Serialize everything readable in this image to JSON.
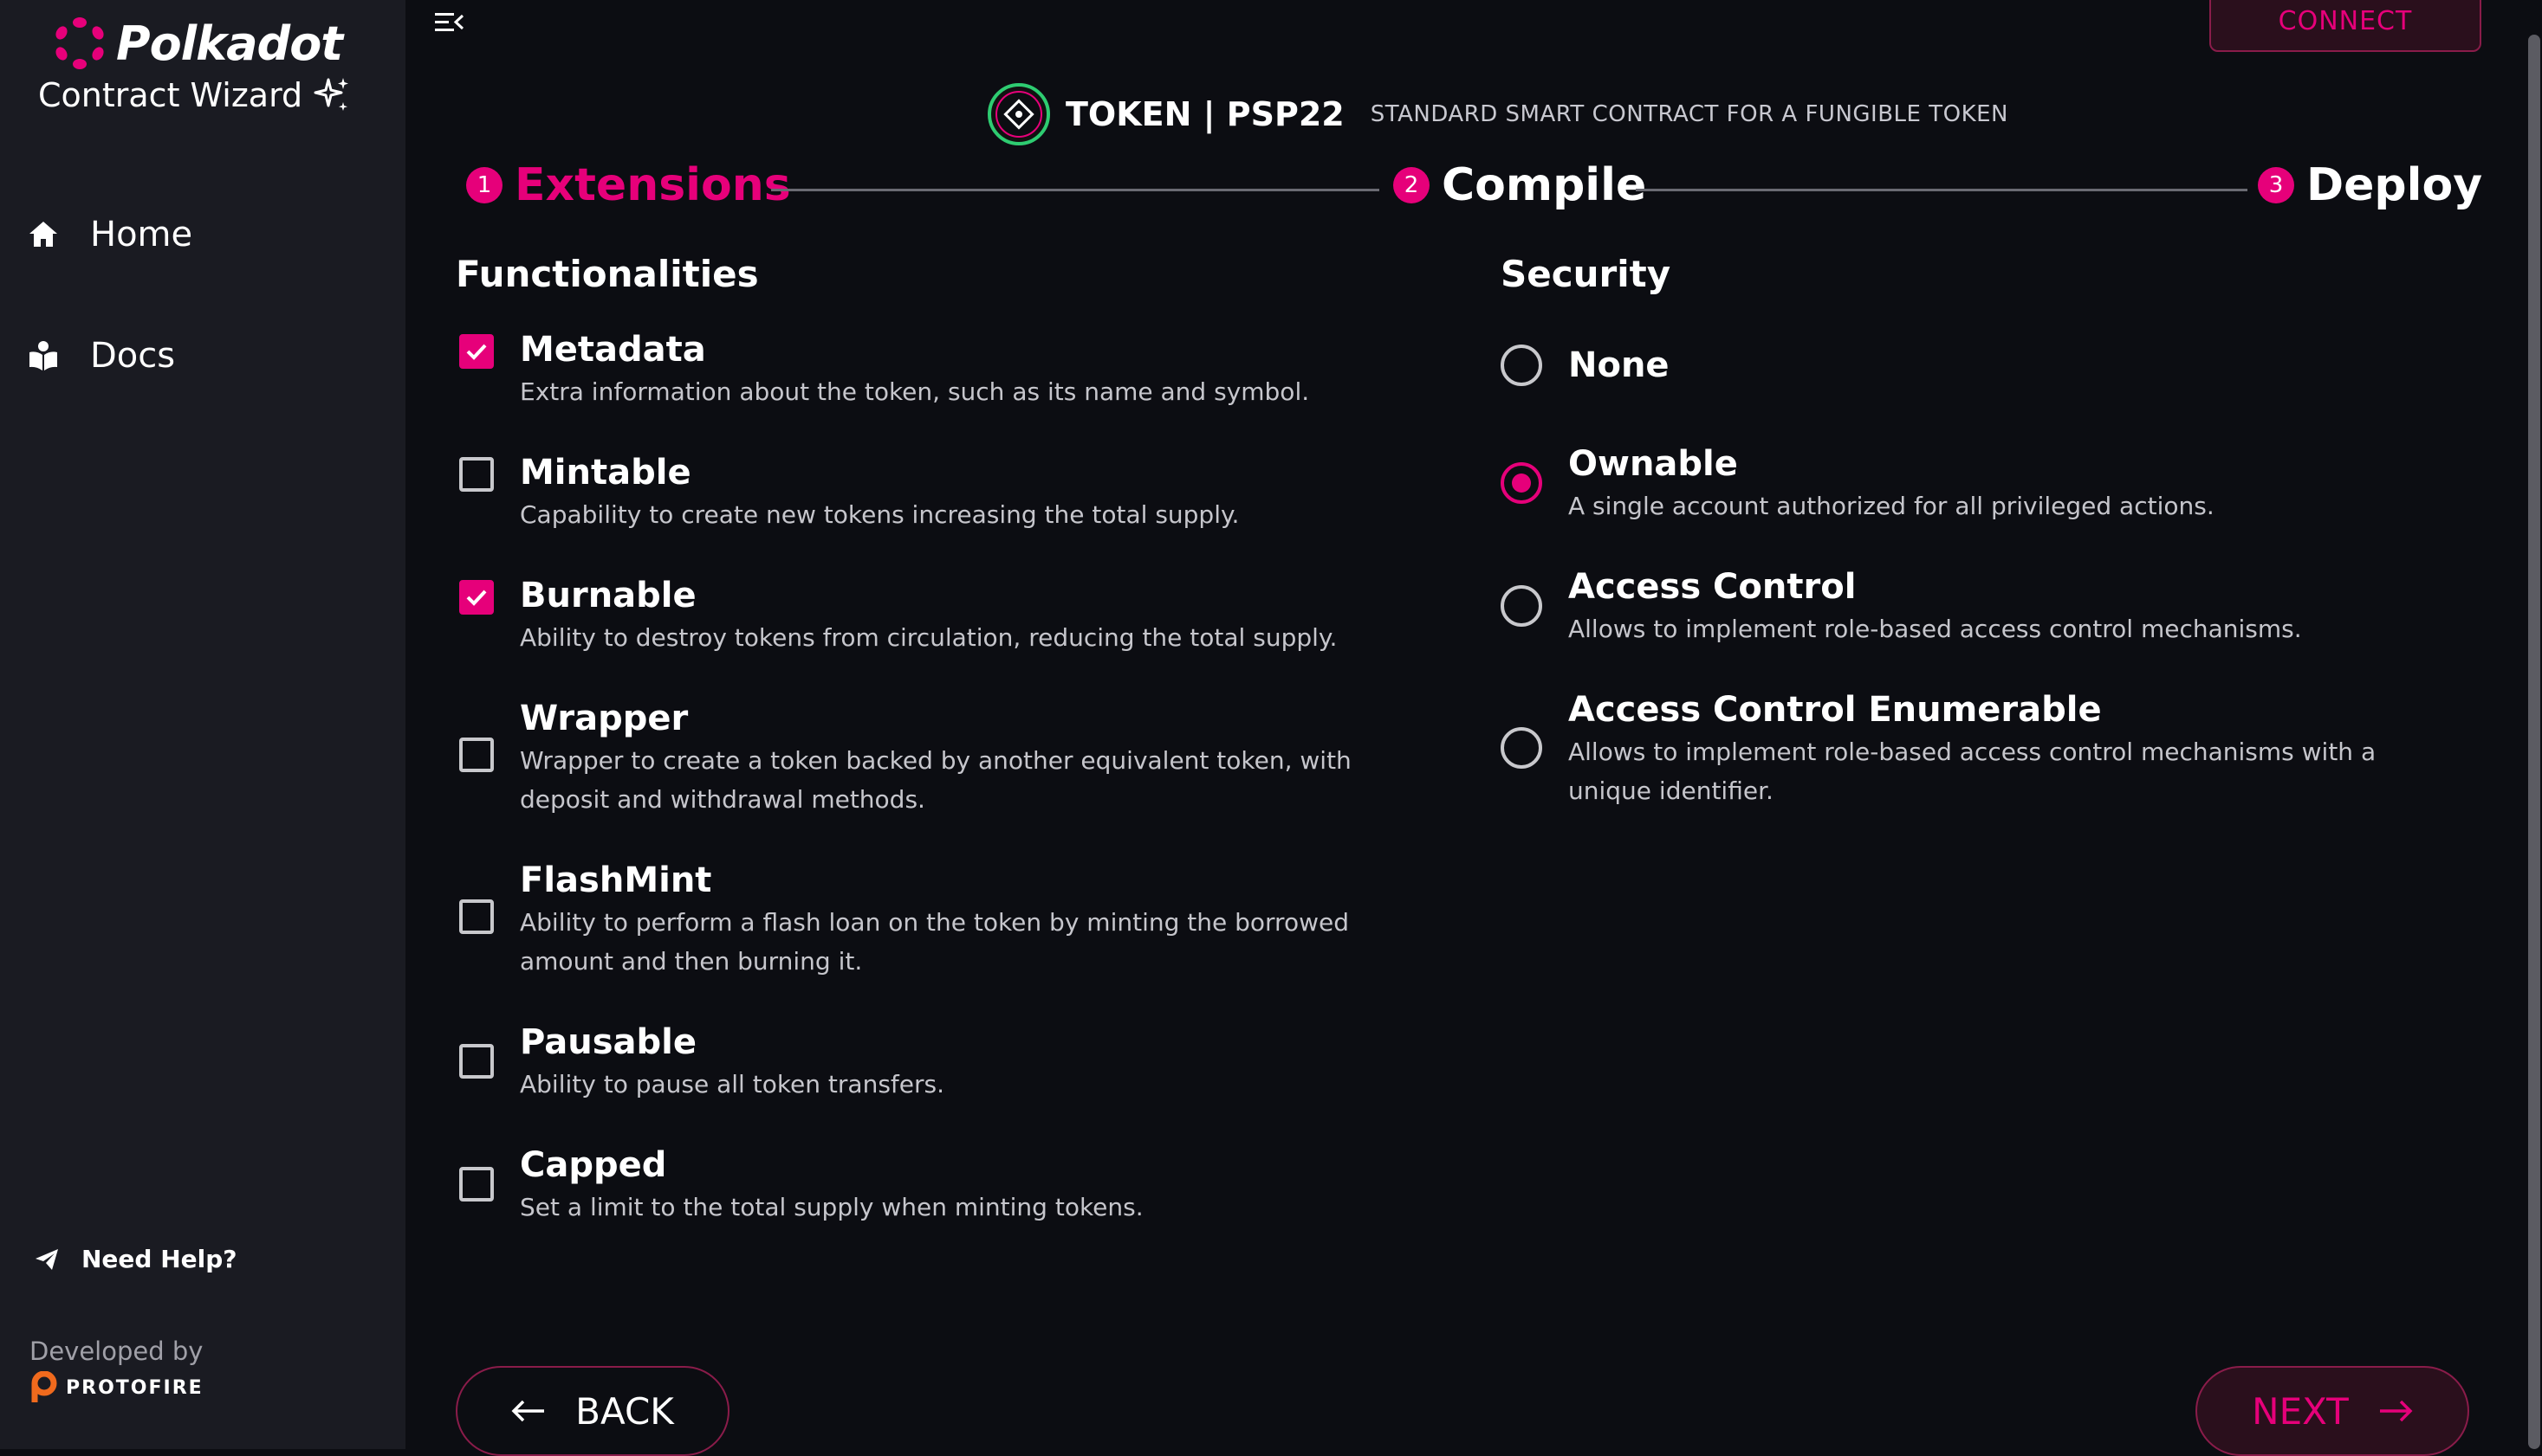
{
  "sidebar": {
    "brand_name": "Polkadot",
    "brand_subtitle": "Contract Wizard",
    "nav": [
      {
        "label": "Home",
        "icon": "home-icon"
      },
      {
        "label": "Docs",
        "icon": "book-icon"
      }
    ],
    "help_label": "Need Help?",
    "developed_by": "Developed by",
    "developer_name": "PROTOFIRE"
  },
  "topbar": {
    "connect_label": "CONNECT"
  },
  "header": {
    "title": "TOKEN | PSP22",
    "subtitle": "STANDARD SMART CONTRACT FOR A FUNGIBLE TOKEN"
  },
  "stepper": {
    "steps": [
      {
        "number": "1",
        "label": "Extensions",
        "active": true
      },
      {
        "number": "2",
        "label": "Compile",
        "active": false
      },
      {
        "number": "3",
        "label": "Deploy",
        "active": false
      }
    ]
  },
  "functionalities": {
    "title": "Functionalities",
    "options": [
      {
        "title": "Metadata",
        "desc": "Extra information about the token, such as its name and symbol.",
        "checked": true
      },
      {
        "title": "Mintable",
        "desc": "Capability to create new tokens increasing the total supply.",
        "checked": false
      },
      {
        "title": "Burnable",
        "desc": "Ability to destroy tokens from circulation, reducing the total supply.",
        "checked": true
      },
      {
        "title": "Wrapper",
        "desc": "Wrapper to create a token backed by another equivalent token, with deposit and withdrawal methods.",
        "checked": false
      },
      {
        "title": "FlashMint",
        "desc": "Ability to perform a flash loan on the token by minting the borrowed amount and then burning it.",
        "checked": false
      },
      {
        "title": "Pausable",
        "desc": "Ability to pause all token transfers.",
        "checked": false
      },
      {
        "title": "Capped",
        "desc": "Set a limit to the total supply when minting tokens.",
        "checked": false
      }
    ]
  },
  "security": {
    "title": "Security",
    "options": [
      {
        "title": "None",
        "desc": "",
        "selected": false
      },
      {
        "title": "Ownable",
        "desc": "A single account authorized for all privileged actions.",
        "selected": true
      },
      {
        "title": "Access Control",
        "desc": "Allows to implement role-based access control mechanisms.",
        "selected": false
      },
      {
        "title": "Access Control Enumerable",
        "desc": "Allows to implement role-based access control mechanisms with a unique identifier.",
        "selected": false
      }
    ]
  },
  "footer": {
    "back_label": "BACK",
    "next_label": "NEXT"
  },
  "colors": {
    "accent": "#e6007a",
    "background": "#0c0d12",
    "sidebar": "#1a1b22"
  }
}
